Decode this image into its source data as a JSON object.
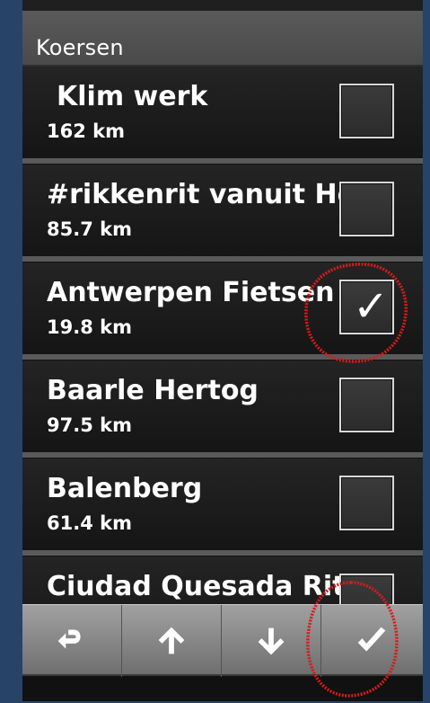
{
  "header": {
    "title": "Koersen"
  },
  "courses": [
    {
      "title": "Klim werk",
      "distance": "162 km",
      "checked": false
    },
    {
      "title": "#rikkenrit vanuit He",
      "distance": "85.7 km",
      "checked": false
    },
    {
      "title": "Antwerpen Fietsen",
      "distance": "19.8 km",
      "checked": true
    },
    {
      "title": "Baarle Hertog",
      "distance": "97.5 km",
      "checked": false
    },
    {
      "title": "Balenberg",
      "distance": "61.4 km",
      "checked": false
    },
    {
      "title": "Ciudad Quesada Rit",
      "distance": "",
      "checked": false
    }
  ],
  "toolbar": {
    "back": "back-icon",
    "up": "arrow-up-icon",
    "down": "arrow-down-icon",
    "confirm": "checkmark-icon"
  },
  "colors": {
    "background": "#274468",
    "accent_red": "#d61b1b"
  }
}
